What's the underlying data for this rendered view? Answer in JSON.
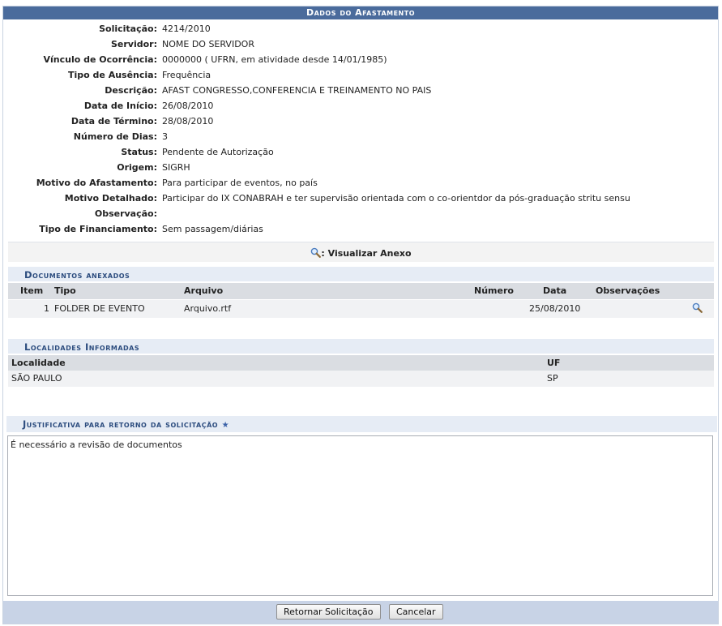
{
  "title": "Dados do Afastamento",
  "fields": [
    {
      "label": "Solicitação:",
      "value": "4214/2010"
    },
    {
      "label": "Servidor:",
      "value": "NOME DO SERVIDOR"
    },
    {
      "label": "Vínculo de Ocorrência:",
      "value": "0000000 ( UFRN, em atividade desde 14/01/1985)"
    },
    {
      "label": "Tipo de Ausência:",
      "value": "Frequência"
    },
    {
      "label": "Descrição:",
      "value": "AFAST CONGRESSO,CONFERENCIA E TREINAMENTO NO PAIS"
    },
    {
      "label": "Data de Início:",
      "value": "26/08/2010"
    },
    {
      "label": "Data de Término:",
      "value": "28/08/2010"
    },
    {
      "label": "Número de Dias:",
      "value": "3"
    },
    {
      "label": "Status:",
      "value": "Pendente de Autorização"
    },
    {
      "label": "Origem:",
      "value": "SIGRH"
    },
    {
      "label": "Motivo do Afastamento:",
      "value": "Para participar de eventos, no país"
    },
    {
      "label": "Motivo Detalhado:",
      "value": "Participar do IX CONABRAH e ter supervisão orientada com o co-orientdor da pós-graduação stritu sensu"
    },
    {
      "label": "Observação:",
      "value": ""
    },
    {
      "label": "Tipo de Financiamento:",
      "value": "Sem passagem/diárias"
    }
  ],
  "view_attachment": ": Visualizar Anexo",
  "documents": {
    "title": "Documentos anexados",
    "headers": {
      "item": "Item",
      "tipo": "Tipo",
      "arquivo": "Arquivo",
      "numero": "Número",
      "data": "Data",
      "obs": "Observações"
    },
    "rows": [
      {
        "item": "1",
        "tipo": "FOLDER DE EVENTO",
        "arquivo": "Arquivo.rtf",
        "numero": "",
        "data": "25/08/2010",
        "obs": ""
      }
    ]
  },
  "locations": {
    "title": "Localidades Informadas",
    "headers": {
      "localidade": "Localidade",
      "uf": "UF"
    },
    "rows": [
      {
        "localidade": "SÃO PAULO",
        "uf": "SP"
      }
    ]
  },
  "justification": {
    "title": "Justificativa para retorno da solicitação",
    "required_mark": "★",
    "value": "É necessário a revisão de documentos"
  },
  "buttons": {
    "return": "Retornar Solicitação",
    "cancel": "Cancelar"
  },
  "icons": {
    "zoom": "magnifier-icon"
  }
}
